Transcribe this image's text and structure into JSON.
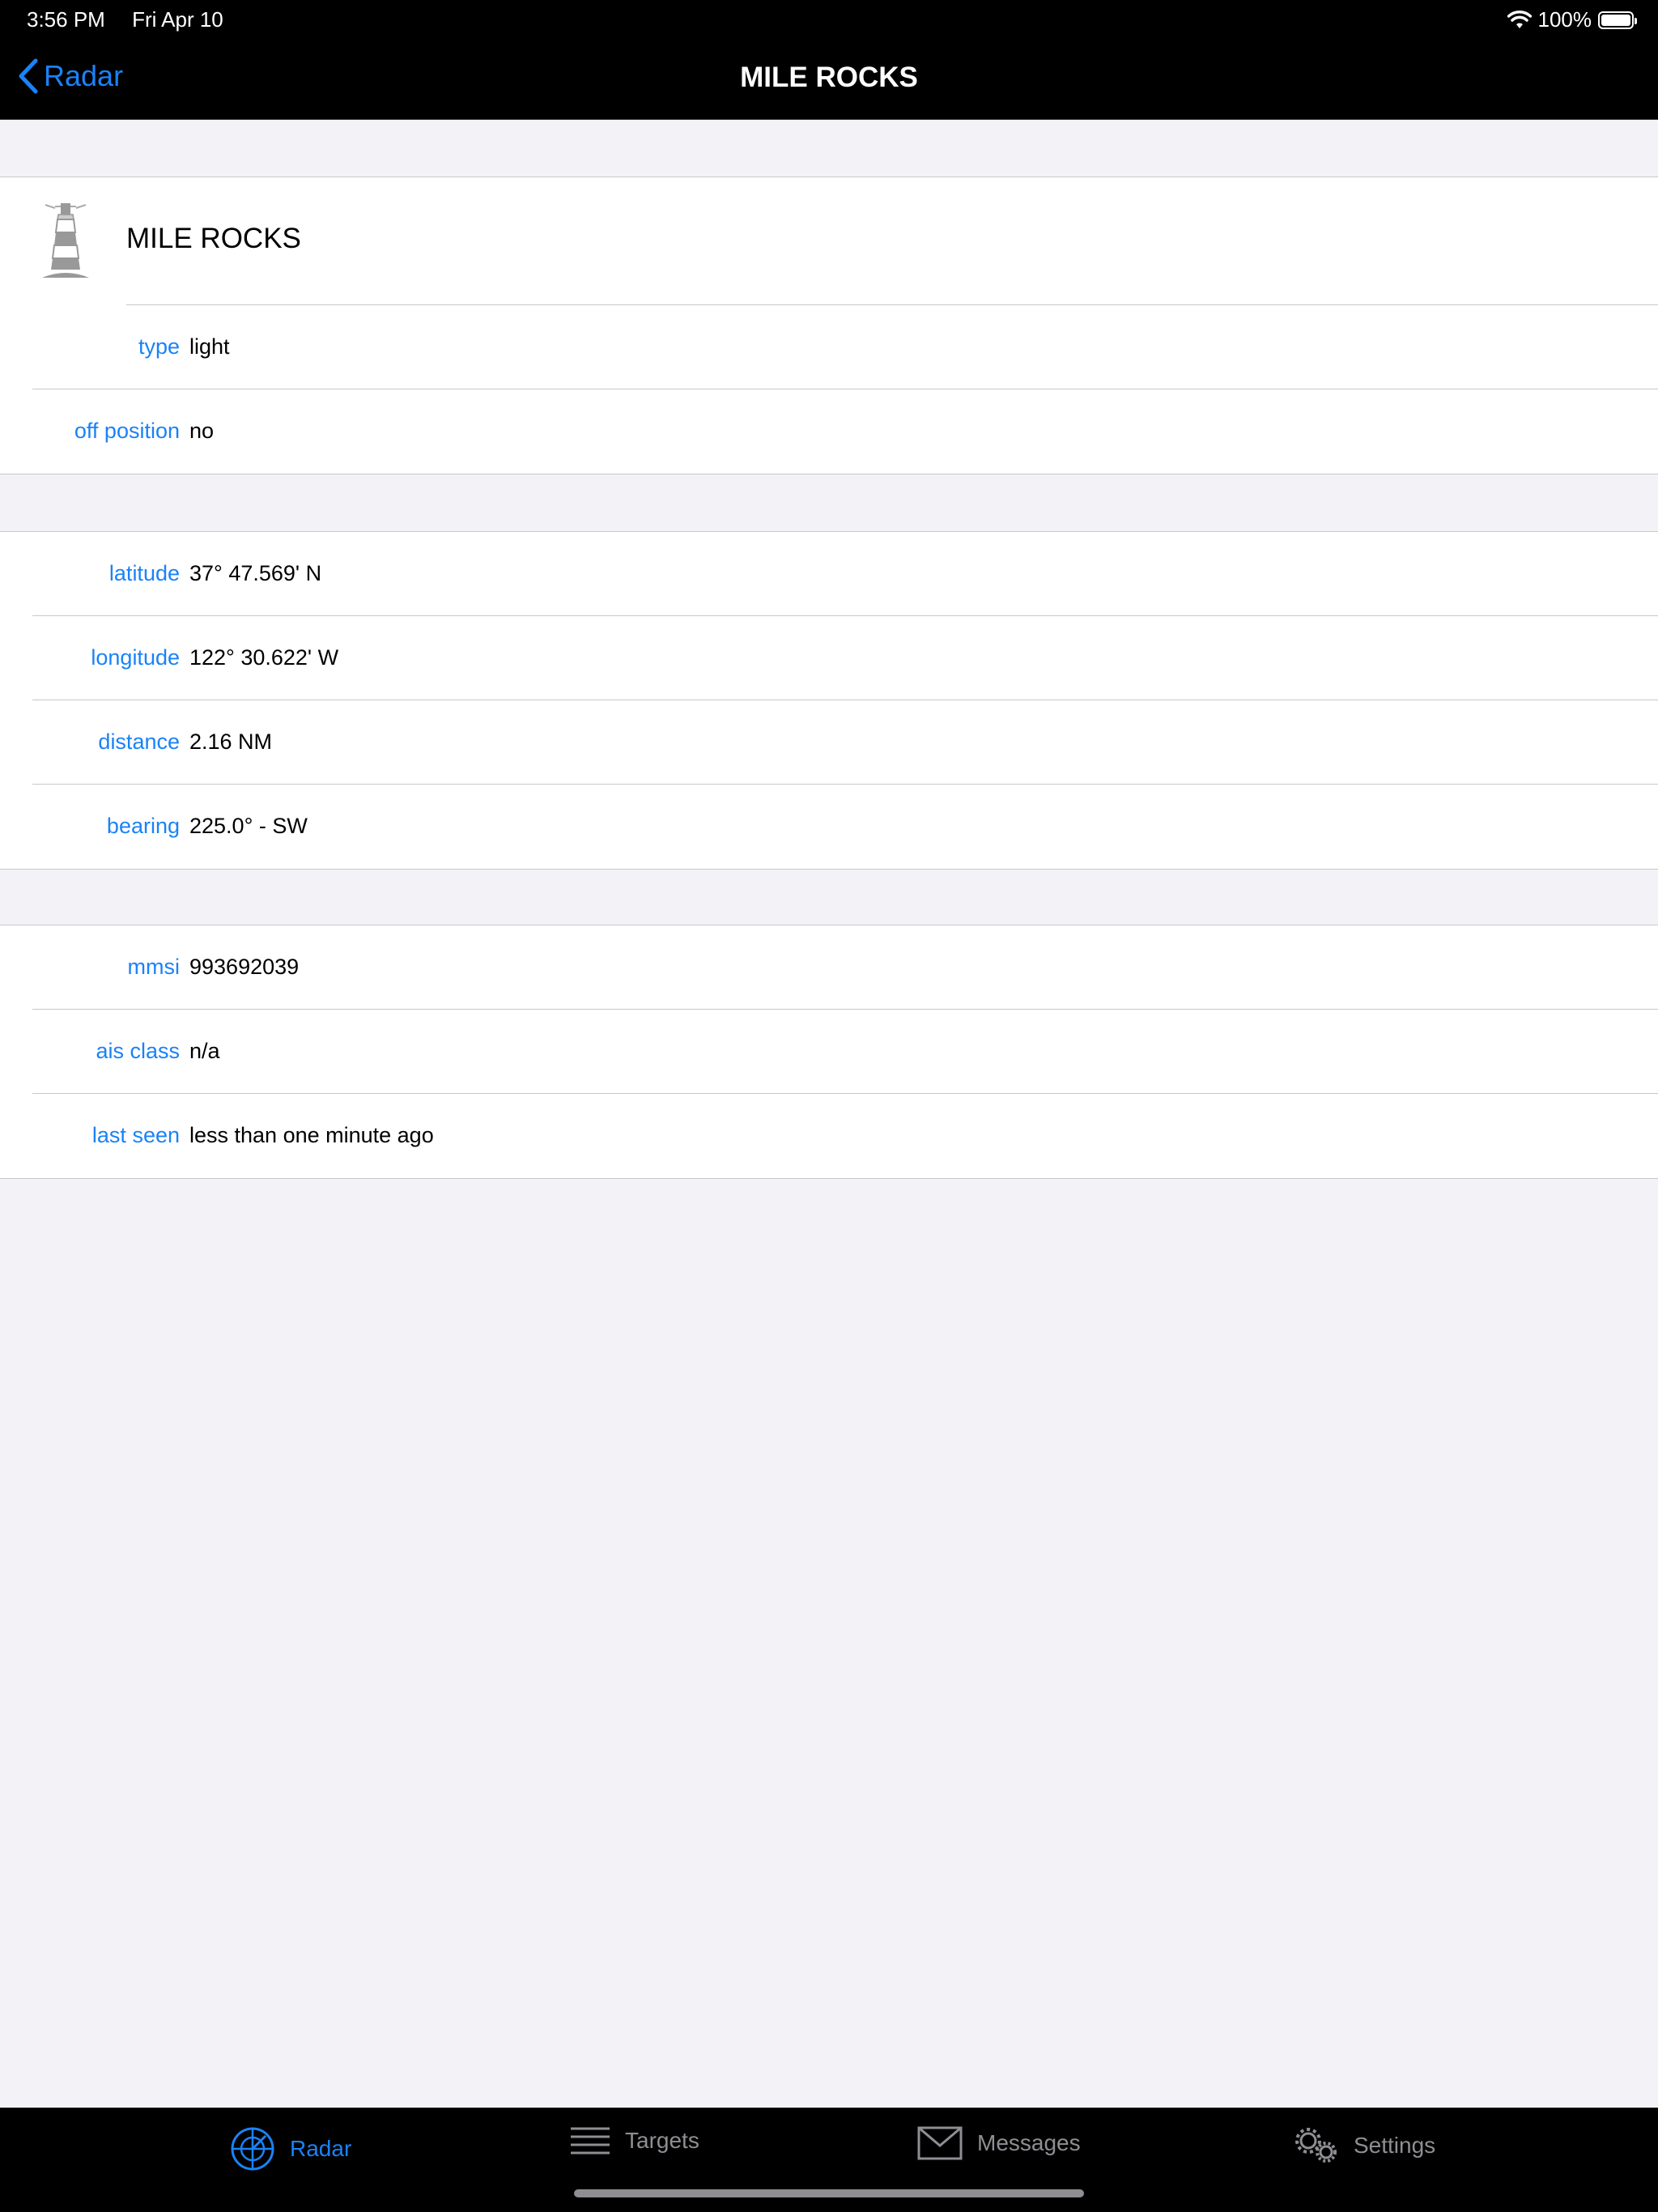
{
  "status": {
    "time": "3:56 PM",
    "date": "Fri Apr 10",
    "battery": "100%"
  },
  "nav": {
    "back_label": "Radar",
    "title": "MILE ROCKS"
  },
  "header": {
    "name": "MILE ROCKS",
    "icon": "lighthouse-icon"
  },
  "sections": [
    {
      "rows": [
        {
          "label": "type",
          "value": "light"
        },
        {
          "label": "off position",
          "value": "no"
        }
      ]
    },
    {
      "rows": [
        {
          "label": "latitude",
          "value": "37° 47.569' N"
        },
        {
          "label": "longitude",
          "value": "122° 30.622' W"
        },
        {
          "label": "distance",
          "value": "2.16 NM"
        },
        {
          "label": "bearing",
          "value": "225.0° - SW"
        }
      ]
    },
    {
      "rows": [
        {
          "label": "mmsi",
          "value": "993692039"
        },
        {
          "label": "ais class",
          "value": "n/a"
        },
        {
          "label": "last seen",
          "value": "less than one minute ago"
        }
      ]
    }
  ],
  "tabs": [
    {
      "label": "Radar",
      "icon": "radar-icon",
      "active": true
    },
    {
      "label": "Targets",
      "icon": "list-icon",
      "active": false
    },
    {
      "label": "Messages",
      "icon": "envelope-icon",
      "active": false
    },
    {
      "label": "Settings",
      "icon": "gears-icon",
      "active": false
    }
  ],
  "colors": {
    "accent": "#1a82f7",
    "inactive": "#8e8e93",
    "background": "#f2f2f7"
  }
}
